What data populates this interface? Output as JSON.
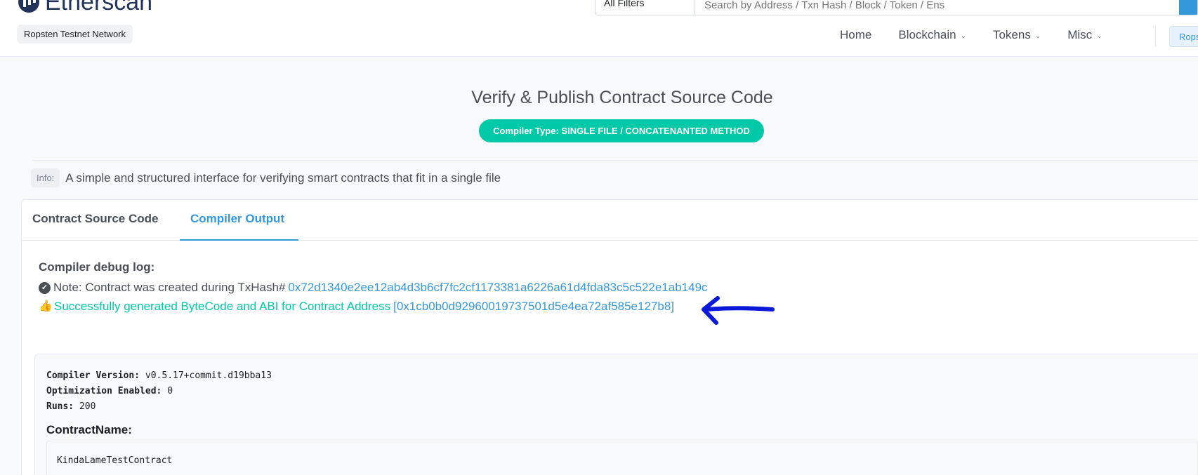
{
  "header": {
    "logo_text": "Etherscan",
    "network_badge": "Ropsten Testnet Network",
    "search": {
      "filter_label": "All Filters",
      "placeholder": "Search by Address / Txn Hash / Block / Token / Ens"
    },
    "nav": {
      "home": "Home",
      "blockchain": "Blockchain",
      "tokens": "Tokens",
      "misc": "Misc",
      "network_pill": "Ropsten"
    }
  },
  "page": {
    "title": "Verify & Publish Contract Source Code",
    "compiler_type": "Compiler Type: SINGLE FILE / CONCATENANTED METHOD",
    "info_tag": "Info:",
    "info_text": "A simple and structured interface for verifying smart contracts that fit in a single file"
  },
  "tabs": {
    "source_code": "Contract Source Code",
    "compiler_output": "Compiler Output"
  },
  "compiler_output": {
    "debug_title": "Compiler debug log:",
    "note_text": "Note: Contract was created during TxHash#",
    "tx_hash": "0x72d1340e2ee12ab4d3b6cf7fc2cf1173381a6226a61d4fda83c5c522e1ab149c",
    "success_text": "Successfully generated ByteCode and ABI for Contract Address",
    "contract_address": "[0x1cb0b0d92960019737501d5e4ea72af585e127b8]",
    "compiler_version_label": "Compiler Version:",
    "compiler_version_value": "v0.5.17+commit.d19bba13",
    "optimization_label": "Optimization Enabled:",
    "optimization_value": "0",
    "runs_label": "Runs:",
    "runs_value": "200",
    "contract_name_label": "ContractName:",
    "contract_name_value": "KindaLameTestContract"
  },
  "colors": {
    "accent": "#3498db",
    "success": "#00c9a7",
    "annotation_arrow": "#0a18d8"
  }
}
